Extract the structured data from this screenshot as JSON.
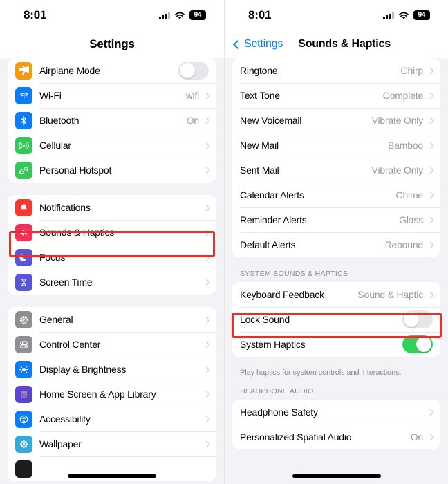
{
  "status_bar": {
    "time": "8:01",
    "battery": "94",
    "signal_icon": "cellular-signal-icon",
    "wifi_icon": "wifi-icon"
  },
  "left_screen": {
    "nav_title": "Settings",
    "groups": [
      {
        "rows": [
          {
            "label": "Airplane Mode",
            "icon": "airplane-icon",
            "icon_color": "#f49b0b",
            "control": "toggle",
            "toggle_on": false
          },
          {
            "label": "Wi-Fi",
            "icon": "wifi-icon",
            "icon_color": "#0a7cf7",
            "value": "wifi",
            "control": "chevron"
          },
          {
            "label": "Bluetooth",
            "icon": "bluetooth-icon",
            "icon_color": "#0a7cf7",
            "value": "On",
            "control": "chevron"
          },
          {
            "label": "Cellular",
            "icon": "cellular-icon",
            "icon_color": "#34c759",
            "value": "",
            "control": "chevron"
          },
          {
            "label": "Personal Hotspot",
            "icon": "hotspot-icon",
            "icon_color": "#34c759",
            "value": "",
            "control": "chevron"
          }
        ]
      },
      {
        "rows": [
          {
            "label": "Notifications",
            "icon": "bell-icon",
            "icon_color": "#f4392f",
            "value": "",
            "control": "chevron"
          },
          {
            "label": "Sounds & Haptics",
            "icon": "speaker-icon",
            "icon_color": "#f4305a",
            "value": "",
            "control": "chevron",
            "highlighted": true
          },
          {
            "label": "Focus",
            "icon": "moon-icon",
            "icon_color": "#5755d9",
            "value": "",
            "control": "chevron"
          },
          {
            "label": "Screen Time",
            "icon": "hourglass-icon",
            "icon_color": "#5755d9",
            "value": "",
            "control": "chevron"
          }
        ]
      },
      {
        "rows": [
          {
            "label": "General",
            "icon": "gear-icon",
            "icon_color": "#8e8e93",
            "value": "",
            "control": "chevron"
          },
          {
            "label": "Control Center",
            "icon": "control-center-icon",
            "icon_color": "#8e8e93",
            "value": "",
            "control": "chevron"
          },
          {
            "label": "Display & Brightness",
            "icon": "brightness-icon",
            "icon_color": "#0a7cf7",
            "value": "",
            "control": "chevron"
          },
          {
            "label": "Home Screen & App Library",
            "icon": "app-grid-icon",
            "icon_color": "#5b44d4",
            "value": "",
            "control": "chevron"
          },
          {
            "label": "Accessibility",
            "icon": "accessibility-icon",
            "icon_color": "#0a7cf7",
            "value": "",
            "control": "chevron"
          },
          {
            "label": "Wallpaper",
            "icon": "wallpaper-icon",
            "icon_color": "#34aadc",
            "value": "",
            "control": "chevron"
          }
        ]
      }
    ]
  },
  "right_screen": {
    "back_label": "Settings",
    "nav_title": "Sounds & Haptics",
    "sound_rows": [
      {
        "label": "Ringtone",
        "value": "Chirp"
      },
      {
        "label": "Text Tone",
        "value": "Complete"
      },
      {
        "label": "New Voicemail",
        "value": "Vibrate Only"
      },
      {
        "label": "New Mail",
        "value": "Bamboo"
      },
      {
        "label": "Sent Mail",
        "value": "Vibrate Only"
      },
      {
        "label": "Calendar Alerts",
        "value": "Chime"
      },
      {
        "label": "Reminder Alerts",
        "value": "Glass"
      },
      {
        "label": "Default Alerts",
        "value": "Rebound"
      }
    ],
    "system_section_header": "SYSTEM SOUNDS & HAPTICS",
    "system_rows": [
      {
        "label": "Keyboard Feedback",
        "value": "Sound & Haptic",
        "control": "chevron"
      },
      {
        "label": "Lock Sound",
        "control": "toggle",
        "toggle_on": false,
        "highlighted": true
      },
      {
        "label": "System Haptics",
        "control": "toggle",
        "toggle_on": true
      }
    ],
    "system_footnote": "Play haptics for system controls and interactions.",
    "headphone_section_header": "HEADPHONE AUDIO",
    "headphone_rows": [
      {
        "label": "Headphone Safety",
        "value": "",
        "control": "chevron"
      },
      {
        "label": "Personalized Spatial Audio",
        "value": "On",
        "control": "chevron"
      }
    ]
  },
  "highlight_color": "#ee2d24"
}
